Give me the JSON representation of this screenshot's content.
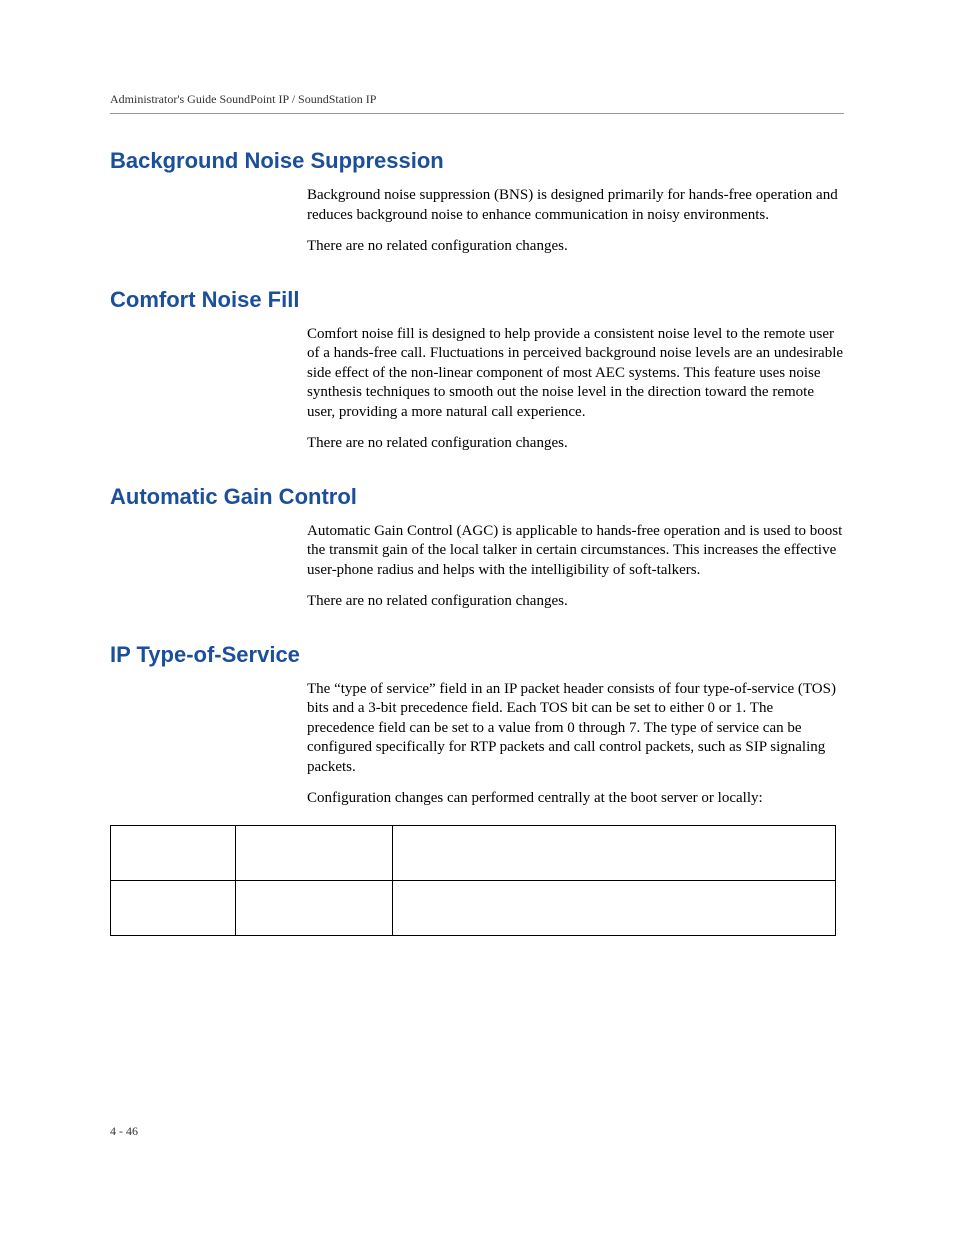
{
  "header": "Administrator's Guide SoundPoint IP / SoundStation IP",
  "footer": "4 - 46",
  "sections": [
    {
      "heading": "Background Noise Suppression",
      "paragraphs": [
        "Background noise suppression (BNS) is designed primarily for hands-free operation and reduces background noise to enhance communication in noisy environments.",
        "There are no related configuration changes."
      ]
    },
    {
      "heading": "Comfort Noise Fill",
      "paragraphs": [
        "Comfort noise fill is designed to help provide a consistent noise level to the remote user of a hands-free call. Fluctuations in perceived background noise levels are an undesirable side effect of the non-linear component of most AEC systems. This feature uses noise synthesis techniques to smooth out the noise level in the direction toward the remote user, providing a more natural call experience.",
        "There are no related configuration changes."
      ]
    },
    {
      "heading": "Automatic Gain Control",
      "paragraphs": [
        "Automatic Gain Control (AGC) is applicable to hands-free operation and is used to boost the transmit gain of the local talker in certain circumstances. This increases the effective user-phone radius and helps with the intelligibility of soft-talkers.",
        "There are no related configuration changes."
      ]
    },
    {
      "heading": "IP Type-of-Service",
      "paragraphs": [
        "The “type of service” field in an IP packet header consists of four type-of-service (TOS) bits and a 3-bit precedence field. Each TOS bit can be set to either 0 or 1. The precedence field can be set to a value from 0 through 7. The type of service can be configured specifically for RTP packets and call control packets, such as SIP signaling packets.",
        "Configuration changes can performed centrally at the boot server or locally:"
      ]
    }
  ]
}
